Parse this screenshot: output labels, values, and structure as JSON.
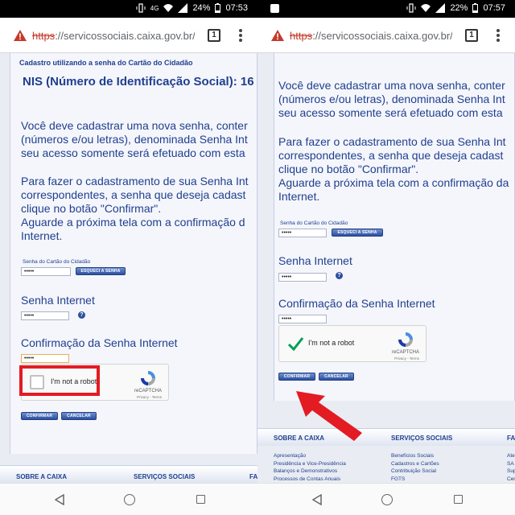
{
  "screens": [
    {
      "status": {
        "network": "4G",
        "battery": "24%",
        "time": "07:53"
      },
      "url": {
        "scheme": "https",
        "rest": "://servicossociais.caixa.gov.br/Ca"
      },
      "tab_count": "1",
      "page": {
        "section_header": "Cadastro utilizando a senha do Cartão do Cidadão",
        "nis_title": "NIS (Número de Identificação Social): 16",
        "para1": "Você deve cadastrar uma nova senha, conter\n(números e/ou letras), denominada Senha Int\nseu acesso somente será efetuado com esta",
        "para2": "Para fazer o cadastramento de sua Senha Int\ncorrespondentes, a senha que deseja cadast\nclique no botão \"Confirmar\".\nAguarde a próxima tela com a confirmação d\nInternet.",
        "card_password_label": "Senha do Cartão do Cidadão",
        "card_password_value": "•••••",
        "forgot_password_button": "ESQUECI A SENHA",
        "internet_password_label": "Senha Internet",
        "internet_password_value": "•••••",
        "confirm_password_label": "Confirmação da Senha Internet",
        "confirm_password_value": "•••••",
        "captcha_label": "I'm not a robot",
        "captcha_brand": "reCAPTCHA",
        "captcha_links": "Privacy - Terms",
        "confirm_button": "CONFIRMAR",
        "cancel_button": "CANCELAR"
      },
      "footer": {
        "col1_title": "SOBRE A CAIXA",
        "col2_title": "SERVIÇOS SOCIAIS",
        "col3_title": "FA"
      }
    },
    {
      "status": {
        "battery": "22%",
        "time": "07:57"
      },
      "url": {
        "scheme": "https",
        "rest": "://servicossociais.caixa.gov.br/Ca"
      },
      "tab_count": "1",
      "page": {
        "para1": "Você deve cadastrar uma nova senha, conter\n(números e/ou letras), denominada Senha Int\nseu acesso somente será efetuado com esta",
        "para2": "Para fazer o cadastramento de sua Senha Int\ncorrespondentes, a senha que deseja cadast\nclique no botão \"Confirmar\".\nAguarde a próxima tela com a confirmação da\nInternet.",
        "card_password_label": "Senha do Cartão do Cidadão",
        "card_password_value": "•••••",
        "forgot_password_button": "ESQUECI A SENHA",
        "internet_password_label": "Senha Internet",
        "internet_password_value": "•••••",
        "confirm_password_label": "Confirmação da Senha Internet",
        "confirm_password_value": "•••••",
        "captcha_label": "I'm not a robot",
        "captcha_brand": "reCAPTCHA",
        "captcha_links": "Privacy - Terms",
        "confirm_button": "CONFIRMAR",
        "cancel_button": "CANCELAR"
      },
      "footer": {
        "col1_title": "SOBRE A CAIXA",
        "col2_title": "SERVIÇOS SOCIAIS",
        "col3_title": "FA",
        "col1_links": [
          "Apresentação",
          "Presidência e Vice-Presidência",
          "Balanços e Demonstrativos",
          "Processos de Contas Anuais"
        ],
        "col2_links": [
          "Benefícios Sociais",
          "Cadastros e Cartões",
          "Contribuição Social",
          "FGTS"
        ],
        "col3_links": [
          "Ate",
          "SA",
          "Sup",
          "Cen"
        ]
      }
    }
  ],
  "colors": {
    "page_text": "#1f3f8f",
    "highlight": "#e31b23",
    "recaptcha_check": "#009e55"
  }
}
